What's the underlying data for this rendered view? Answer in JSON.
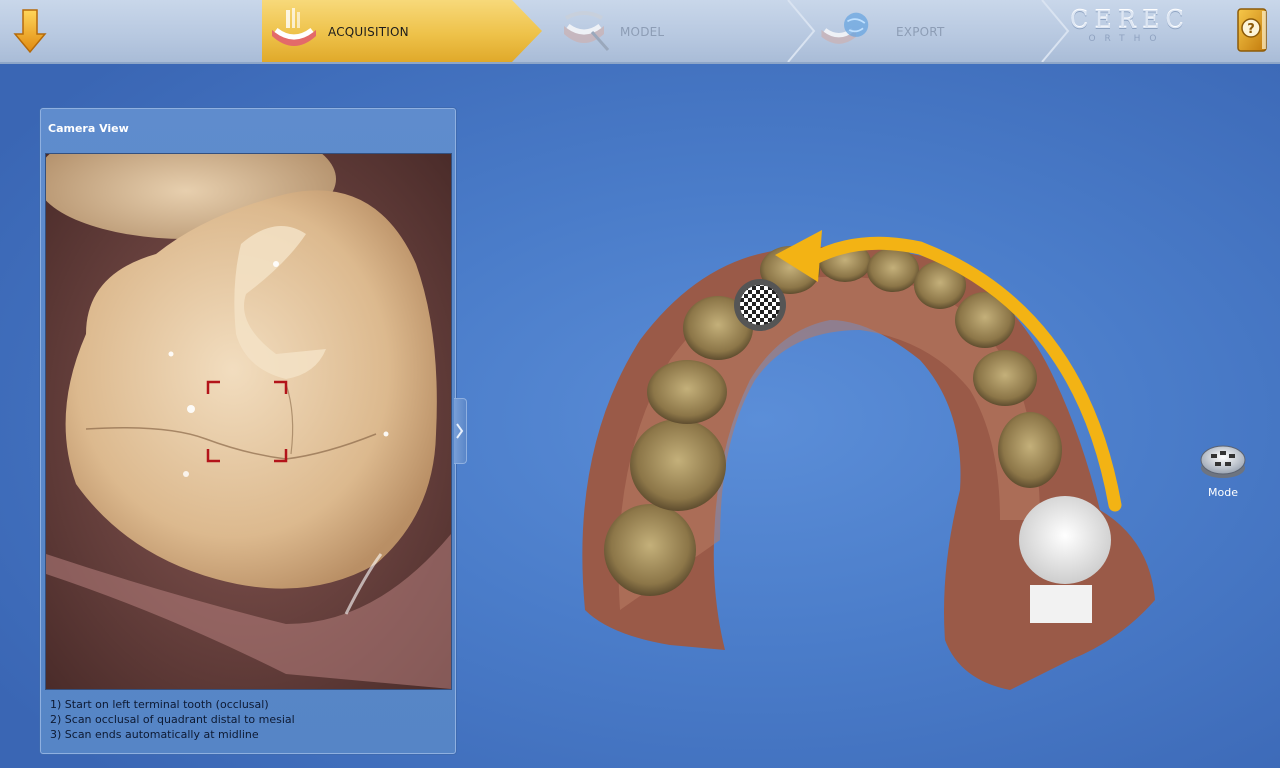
{
  "toolbar": {
    "steps": [
      {
        "label": "ACQUISITION",
        "state": "active",
        "icon": "teeth-scan-icon"
      },
      {
        "label": "MODEL",
        "state": "inactive",
        "icon": "model-icon"
      },
      {
        "label": "EXPORT",
        "state": "inactive",
        "icon": "export-icon"
      }
    ],
    "logo": {
      "main": "CEREC",
      "sub": "ORTHO"
    },
    "back_icon": "down-arrow-icon",
    "help_icon": "help-book-icon"
  },
  "camera_panel": {
    "title": "Camera View",
    "instructions": [
      "1) Start on left terminal tooth (occlusal)",
      "2) Scan occlusal of quadrant distal to mesial",
      "3) Scan ends automatically at midline"
    ]
  },
  "mode_button": {
    "label": "Mode",
    "icon": "mode-wheel-icon"
  },
  "colors": {
    "accent": "#eec24a",
    "background": "#4a7cc9",
    "scan_arrow": "#f3b314",
    "target_marker": "#b3141a"
  }
}
